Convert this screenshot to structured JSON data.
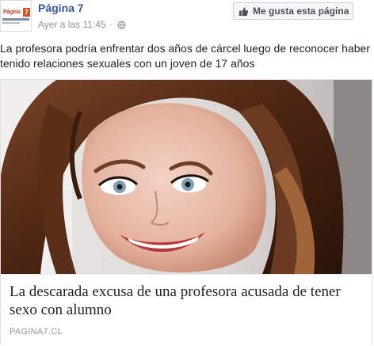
{
  "header": {
    "logo_text": "Página",
    "logo_mark": "7",
    "page_name": "Página 7",
    "timestamp": "Ayer a las 11:45",
    "separator": "·",
    "privacy_icon": "globe-icon",
    "like_page_label": "Me gusta esta página",
    "like_icon": "thumbs-up-icon"
  },
  "post": {
    "caption": "La profesora podría enfrentar dos años de cárcel luego de reconocer haber tenido relaciones sexuales con un joven de 17 años"
  },
  "link_card": {
    "image": "selfie-photo",
    "title": "La descarada excusa de una profesora acusada de tener sexo con alumno",
    "domain": "PAGINA7.CL"
  },
  "colors": {
    "page_name": "#365899",
    "meta_text": "#90949c",
    "body_text": "#1d2129",
    "button_bg": "#f6f7f9",
    "button_border": "#ced0d4"
  }
}
